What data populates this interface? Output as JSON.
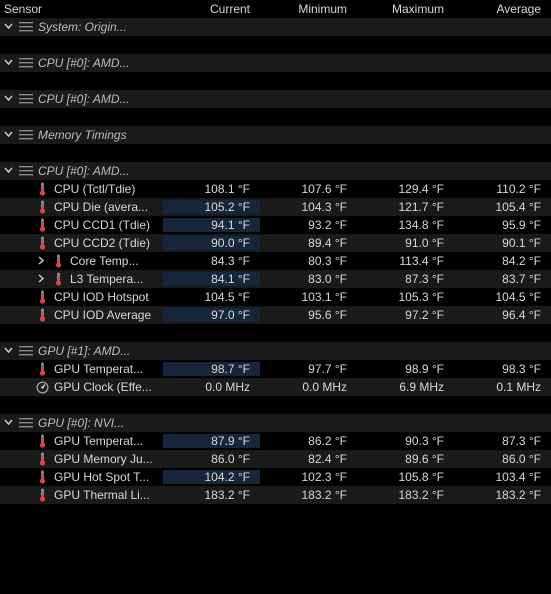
{
  "columns": {
    "sensor": "Sensor",
    "current": "Current",
    "minimum": "Minimum",
    "maximum": "Maximum",
    "average": "Average"
  },
  "units": {
    "temp": "°F",
    "mhz": "MHz"
  },
  "groups": [
    {
      "label": "System: Origin...",
      "expanded": true,
      "icon": "bars-icon",
      "rows": []
    },
    {
      "label": "CPU [#0]: AMD...",
      "expanded": true,
      "icon": "bars-icon",
      "rows": []
    },
    {
      "label": "CPU [#0]: AMD...",
      "expanded": true,
      "icon": "bars-icon",
      "rows": []
    },
    {
      "label": "Memory Timings",
      "expanded": true,
      "icon": "bars-icon",
      "rows": []
    },
    {
      "label": "CPU [#0]: AMD...",
      "expanded": true,
      "icon": "bars-icon",
      "rows": [
        {
          "indent": 1,
          "icon": "thermometer-icon",
          "label": "CPU (Tctl/Tdie)",
          "cur": "108.1 °F",
          "min": "107.6 °F",
          "max": "129.4 °F",
          "avg": "110.2 °F",
          "hot": false
        },
        {
          "indent": 1,
          "icon": "thermometer-icon",
          "label": "CPU Die (avera...",
          "cur": "105.2 °F",
          "min": "104.3 °F",
          "max": "121.7 °F",
          "avg": "105.4 °F",
          "hot": true
        },
        {
          "indent": 1,
          "icon": "thermometer-icon",
          "label": "CPU CCD1 (Tdie)",
          "cur": "94.1 °F",
          "min": "93.2 °F",
          "max": "134.8 °F",
          "avg": "95.9 °F",
          "hot": true
        },
        {
          "indent": 1,
          "icon": "thermometer-icon",
          "label": "CPU CCD2 (Tdie)",
          "cur": "90.0 °F",
          "min": "89.4 °F",
          "max": "91.0 °F",
          "avg": "90.1 °F",
          "hot": true
        },
        {
          "indent": 2,
          "caret": "collapsed",
          "icon": "thermometer-icon",
          "label": "Core Temp...",
          "cur": "84.3 °F",
          "min": "80.3 °F",
          "max": "113.4 °F",
          "avg": "84.2 °F",
          "hot": false
        },
        {
          "indent": 2,
          "caret": "collapsed",
          "icon": "thermometer-icon",
          "label": "L3 Tempera...",
          "cur": "84.1 °F",
          "min": "83.0 °F",
          "max": "87.3 °F",
          "avg": "83.7 °F",
          "hot": true
        },
        {
          "indent": 1,
          "icon": "thermometer-icon",
          "label": "CPU IOD Hotspot",
          "cur": "104.5 °F",
          "min": "103.1 °F",
          "max": "105.3 °F",
          "avg": "104.5 °F",
          "hot": false
        },
        {
          "indent": 1,
          "icon": "thermometer-icon",
          "label": "CPU IOD Average",
          "cur": "97.0 °F",
          "min": "95.6 °F",
          "max": "97.2 °F",
          "avg": "96.4 °F",
          "hot": true
        }
      ]
    },
    {
      "label": "GPU [#1]: AMD...",
      "expanded": true,
      "icon": "bars-icon",
      "rows": [
        {
          "indent": 1,
          "icon": "thermometer-icon",
          "label": "GPU Temperat...",
          "cur": "98.7 °F",
          "min": "97.7 °F",
          "max": "98.9 °F",
          "avg": "98.3 °F",
          "hot": true
        },
        {
          "indent": 1,
          "icon": "gauge-icon",
          "label": "GPU Clock (Effe...",
          "cur": "0.0 MHz",
          "min": "0.0 MHz",
          "max": "6.9 MHz",
          "avg": "0.1 MHz",
          "hot": false
        }
      ]
    },
    {
      "label": "GPU [#0]: NVI...",
      "expanded": true,
      "icon": "bars-icon",
      "rows": [
        {
          "indent": 1,
          "icon": "thermometer-icon",
          "label": "GPU Temperat...",
          "cur": "87.9 °F",
          "min": "86.2 °F",
          "max": "90.3 °F",
          "avg": "87.3 °F",
          "hot": true
        },
        {
          "indent": 1,
          "icon": "thermometer-icon",
          "label": "GPU Memory Ju...",
          "cur": "86.0 °F",
          "min": "82.4 °F",
          "max": "89.6 °F",
          "avg": "86.0 °F",
          "hot": false
        },
        {
          "indent": 1,
          "icon": "thermometer-icon",
          "label": "GPU Hot Spot T...",
          "cur": "104.2 °F",
          "min": "102.3 °F",
          "max": "105.8 °F",
          "avg": "103.4 °F",
          "hot": true
        },
        {
          "indent": 1,
          "icon": "thermometer-icon",
          "label": "GPU Thermal Li...",
          "cur": "183.2 °F",
          "min": "183.2 °F",
          "max": "183.2 °F",
          "avg": "183.2 °F",
          "hot": false
        }
      ]
    }
  ]
}
